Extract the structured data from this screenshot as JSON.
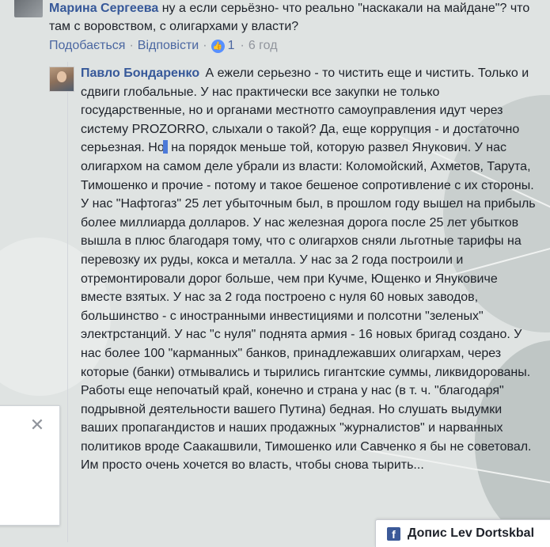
{
  "top_comment": {
    "author": "Марина Сергеева",
    "text": " ну а если серьёзно- что реально \"наскакали на майдане\"? что там с воровством, с олигархами у власти?",
    "actions": {
      "like": "Подобається",
      "reply": "Відповісти",
      "like_count": "1",
      "time": "6 год"
    }
  },
  "reply": {
    "author": "Павло Бондаренко",
    "text_before_cursor": " А ежели серьезно - то чистить еще и чистить. Только и сдвиги глобальные. У нас практически все закупки не только государственные, но и органами местнотго самоуправления идут через систему PROZORRO, слыхали о такой? Да, еще коррупция - и достаточно серьезная. Но",
    "text_after_cursor": " на порядок меньше той, которую развел Янукович. У нас олигархом на самом деле убрали из власти: Коломойский, Ахметов, Тарута, Тимошенко и прочие - потому и такое бешеное сопротивление с их стороны. У нас \"Нафтогаз\" 25 лет убыточным был, в прошлом году вышел на прибыль более миллиарда долларов. У нас железная дорога после 25 лет убытков вышла в плюс благодаря тому, что с олигархов сняли льготные тарифы на перевозку их руды, кокса и металла. У нас за 2 года построили и отремонтировали дорог больше, чем при Кучме, Ющенко и Януковиче вместе взятых. У нас за 2 года построено с нуля 60 новых заводов, большинство - с иностранными инвестициями и полсотни \"зеленых\" электрстанций. У нас \"с нуля\" поднята армия - 16 новых бригад создано. У нас более 100 \"карманных\" банков, принадлежавших олигархам, через которые (банки) отмывались и тырились гигантские суммы, ликвидорованы. Работы еще непочатый край, конечно и страна у нас (в т. ч. \"благодаря\" подрывной деятельности вашего Путина) бедная. Но слушать выдумки ваших пропагандистов и наших продажных \"журналистов\" и нарванных политиков вроде Саакашвили, Тимошенко или Савченко я бы не советовал. Им просто очень хочется во власть, чтобы снова тырить..."
  },
  "popup": {
    "close_symbol": "✕"
  },
  "chat_tab": {
    "icon_letter": "f",
    "label": "Допис Lev Dortskbal"
  },
  "icons": {
    "like": "thumbs-up-icon",
    "close": "close-icon",
    "facebook": "facebook-icon"
  },
  "colors": {
    "link": "#365899",
    "like": "#5890ff",
    "meta": "#90949c"
  }
}
